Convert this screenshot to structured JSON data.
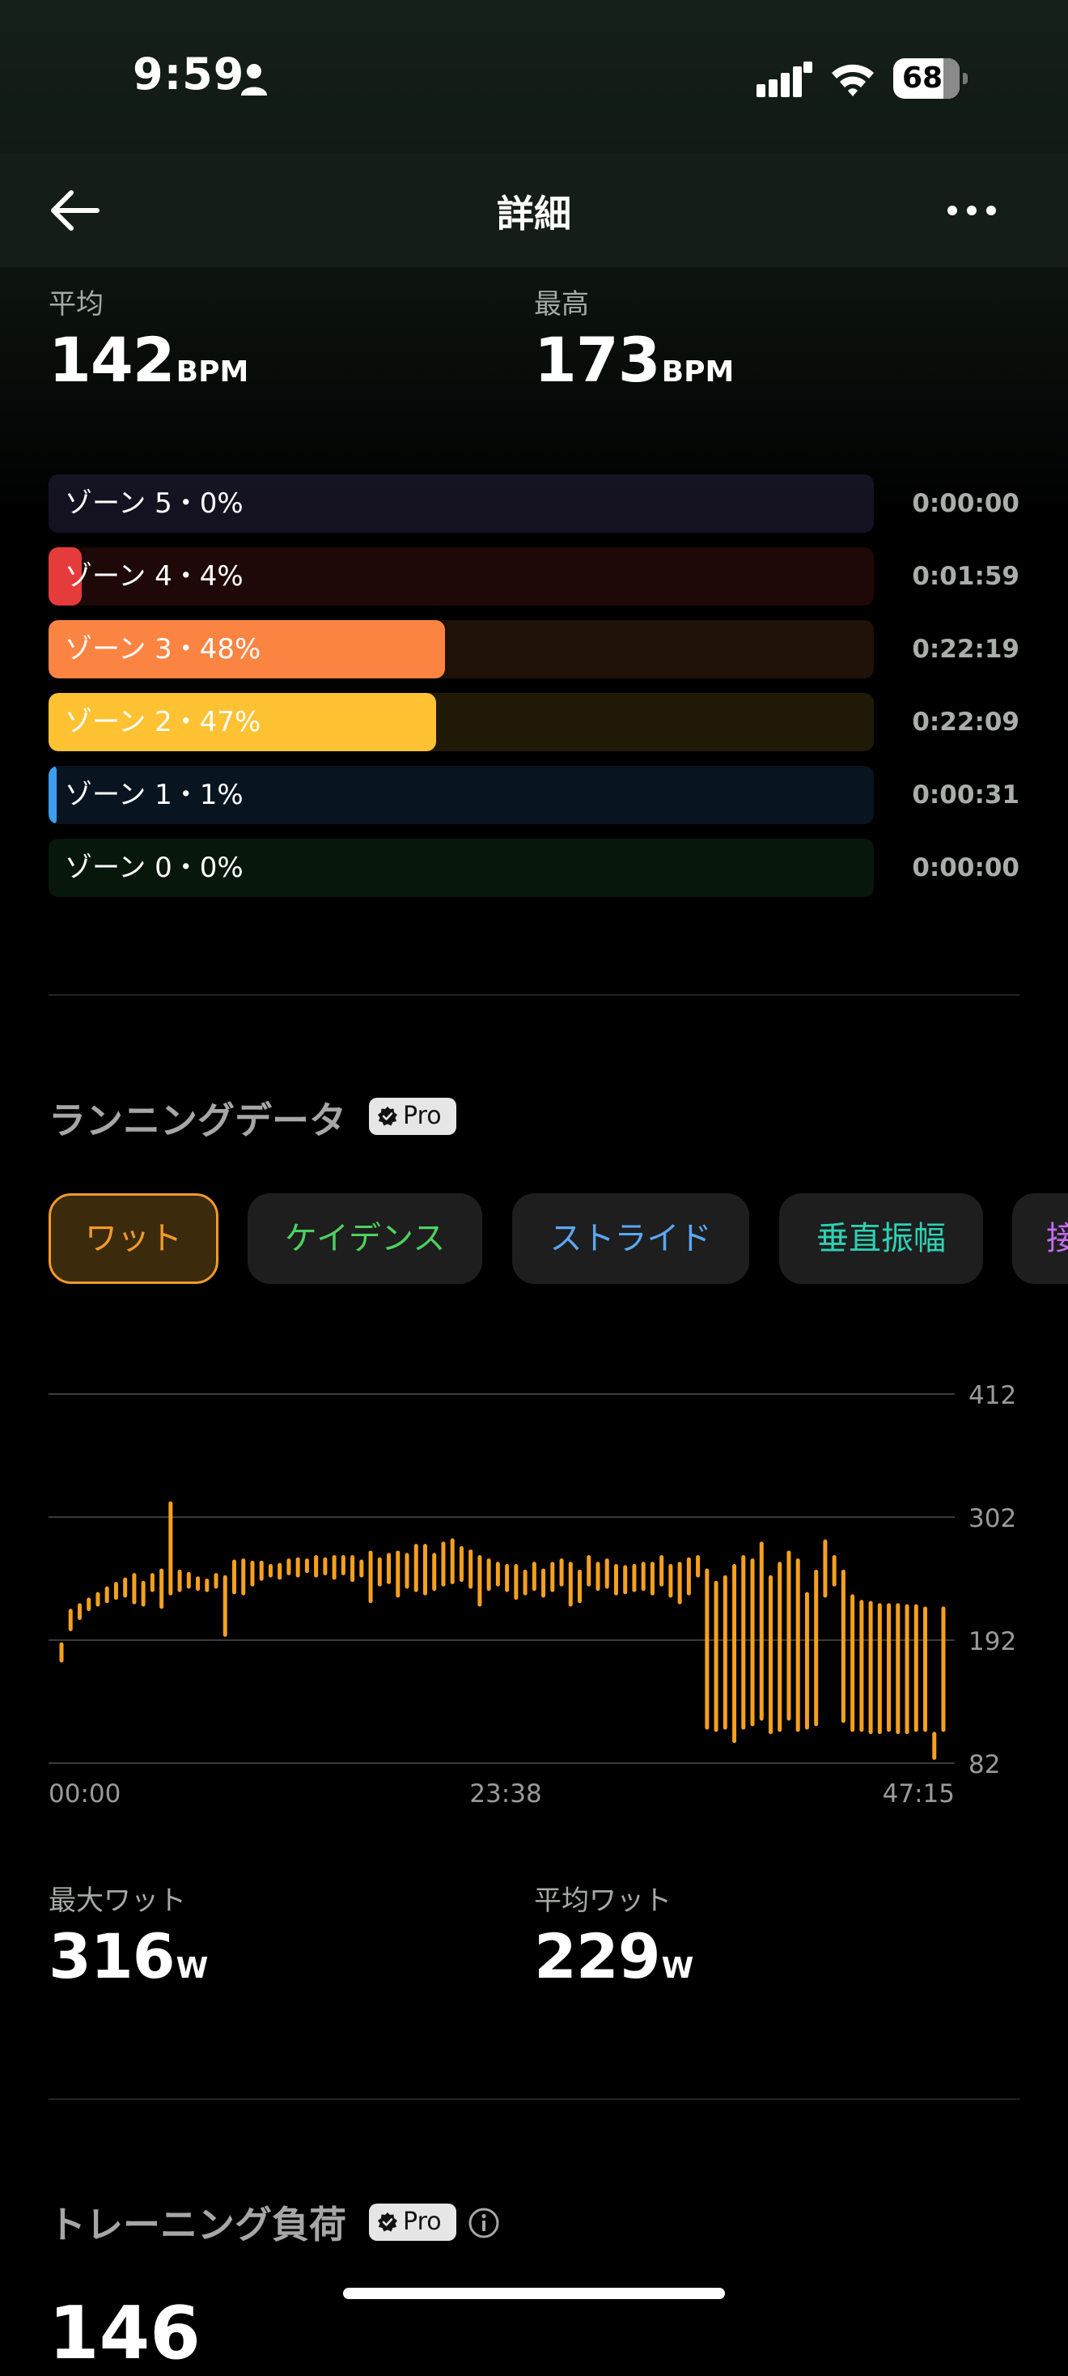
{
  "status": {
    "time": "9:59",
    "battery": "68"
  },
  "nav": {
    "title": "詳細"
  },
  "heart_rate": {
    "avg_label": "平均",
    "avg_value": "142",
    "avg_unit": "BPM",
    "max_label": "最高",
    "max_value": "173",
    "max_unit": "BPM"
  },
  "zones": [
    {
      "label": "ゾーン 5・0%",
      "time": "0:00:00",
      "percent": 0,
      "color": "#9b8cff"
    },
    {
      "label": "ゾーン 4・4%",
      "time": "0:01:59",
      "percent": 4,
      "color": "#e53b3b"
    },
    {
      "label": "ゾーン 3・48%",
      "time": "0:22:19",
      "percent": 48,
      "color": "#fb8442"
    },
    {
      "label": "ゾーン 2・47%",
      "time": "0:22:09",
      "percent": 47,
      "color": "#ffc233"
    },
    {
      "label": "ゾーン 1・1%",
      "time": "0:00:31",
      "percent": 1,
      "color": "#3d9df0"
    },
    {
      "label": "ゾーン 0・0%",
      "time": "0:00:00",
      "percent": 0,
      "color": "#35b260"
    }
  ],
  "running": {
    "title": "ランニングデータ",
    "pro": "Pro",
    "tabs": [
      {
        "label": "ワット",
        "color": "#f29a2b"
      },
      {
        "label": "ケイデンス",
        "color": "#4cd15f"
      },
      {
        "label": "ストライド",
        "color": "#5aa8f2"
      },
      {
        "label": "垂直振幅",
        "color": "#2ed1b4"
      },
      {
        "label": "接",
        "color": "#c36bf2"
      }
    ]
  },
  "chart_data": {
    "type": "bar",
    "series_color": "#f5a01e",
    "y_ticks": [
      "412",
      "302",
      "192",
      "82"
    ],
    "ylim": [
      82,
      412
    ],
    "x_ticks": [
      "00:00",
      "23:38",
      "47:15"
    ],
    "xlim_minutes": [
      0,
      47.25
    ],
    "ranges": [
      [
        172,
        190
      ],
      [
        200,
        220
      ],
      [
        210,
        225
      ],
      [
        218,
        230
      ],
      [
        222,
        235
      ],
      [
        225,
        240
      ],
      [
        228,
        244
      ],
      [
        230,
        248
      ],
      [
        224,
        252
      ],
      [
        222,
        245
      ],
      [
        235,
        252
      ],
      [
        220,
        256
      ],
      [
        232,
        316
      ],
      [
        235,
        255
      ],
      [
        238,
        253
      ],
      [
        236,
        249
      ],
      [
        235,
        247
      ],
      [
        238,
        252
      ],
      [
        195,
        250
      ],
      [
        233,
        264
      ],
      [
        232,
        265
      ],
      [
        240,
        263
      ],
      [
        245,
        263
      ],
      [
        248,
        260
      ],
      [
        246,
        261
      ],
      [
        250,
        265
      ],
      [
        248,
        266
      ],
      [
        252,
        265
      ],
      [
        248,
        268
      ],
      [
        250,
        266
      ],
      [
        246,
        268
      ],
      [
        250,
        268
      ],
      [
        244,
        268
      ],
      [
        248,
        264
      ],
      [
        225,
        272
      ],
      [
        240,
        266
      ],
      [
        242,
        270
      ],
      [
        230,
        272
      ],
      [
        238,
        270
      ],
      [
        235,
        278
      ],
      [
        232,
        278
      ],
      [
        236,
        270
      ],
      [
        240,
        280
      ],
      [
        242,
        283
      ],
      [
        244,
        276
      ],
      [
        238,
        273
      ],
      [
        222,
        268
      ],
      [
        236,
        265
      ],
      [
        240,
        262
      ],
      [
        235,
        260
      ],
      [
        228,
        260
      ],
      [
        232,
        255
      ],
      [
        236,
        262
      ],
      [
        230,
        256
      ],
      [
        235,
        262
      ],
      [
        240,
        265
      ],
      [
        222,
        262
      ],
      [
        225,
        255
      ],
      [
        240,
        268
      ],
      [
        236,
        262
      ],
      [
        238,
        265
      ],
      [
        232,
        260
      ],
      [
        233,
        259
      ],
      [
        235,
        260
      ],
      [
        236,
        262
      ],
      [
        232,
        262
      ],
      [
        240,
        268
      ],
      [
        230,
        260
      ],
      [
        224,
        262
      ],
      [
        232,
        266
      ],
      [
        248,
        268
      ],
      [
        112,
        256
      ],
      [
        110,
        245
      ],
      [
        112,
        250
      ],
      [
        100,
        260
      ],
      [
        112,
        268
      ],
      [
        115,
        265
      ],
      [
        120,
        280
      ],
      [
        108,
        250
      ],
      [
        110,
        262
      ],
      [
        120,
        272
      ],
      [
        110,
        265
      ],
      [
        112,
        235
      ],
      [
        115,
        255
      ],
      [
        230,
        282
      ],
      [
        240,
        268
      ],
      [
        118,
        255
      ],
      [
        110,
        233
      ],
      [
        110,
        228
      ],
      [
        108,
        227
      ],
      [
        108,
        225
      ],
      [
        110,
        225
      ],
      [
        108,
        225
      ],
      [
        108,
        224
      ],
      [
        110,
        224
      ],
      [
        110,
        222
      ],
      [
        85,
        110
      ],
      [
        110,
        222
      ]
    ]
  },
  "watts": {
    "max_label": "最大ワット",
    "max_value": "316",
    "max_unit": "W",
    "avg_label": "平均ワット",
    "avg_value": "229",
    "avg_unit": "W"
  },
  "training": {
    "title": "トレーニング負荷",
    "pro": "Pro",
    "value": "146"
  }
}
